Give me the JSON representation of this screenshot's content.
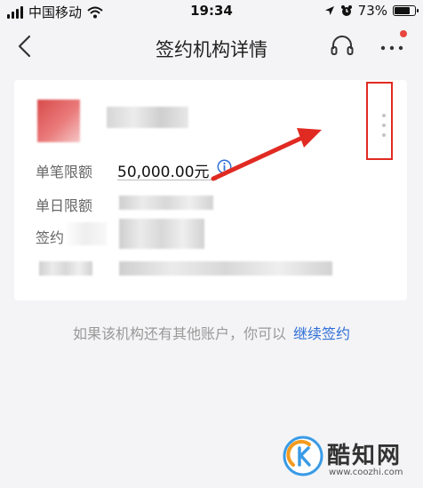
{
  "status_bar": {
    "carrier": "中国移动",
    "time": "19:34",
    "battery": "73%"
  },
  "nav": {
    "title": "签约机构详情"
  },
  "card": {
    "rows": [
      {
        "label": "单笔限额",
        "value": "50,000.00元"
      },
      {
        "label": "单日限额",
        "value": ""
      },
      {
        "label": "签约",
        "value": ""
      },
      {
        "label": "",
        "value": ""
      }
    ]
  },
  "hint": {
    "text": "如果该机构还有其他账户，你可以",
    "link": "继续签约"
  },
  "watermark": {
    "brand": "酷知网",
    "url": "www.coozhi.com"
  },
  "colors": {
    "accent_link": "#2f6fd7",
    "annotation_red": "#e02a22",
    "background": "#f4f4f6"
  }
}
